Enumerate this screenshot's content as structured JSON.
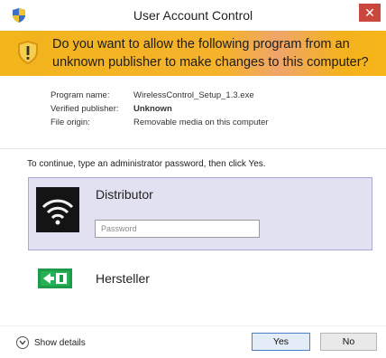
{
  "window": {
    "title": "User Account Control",
    "close_label": "✕"
  },
  "banner": {
    "question": "Do you want to allow the following program from an unknown publisher to make changes to this computer?"
  },
  "program_info": {
    "rows": [
      {
        "label": "Program name:",
        "value": "WirelessControl_Setup_1.3.exe"
      },
      {
        "label": "Verified publisher:",
        "value": "Unknown"
      },
      {
        "label": "File origin:",
        "value": "Removable media on this computer"
      }
    ]
  },
  "instruction": "To continue, type an administrator password, then click Yes.",
  "accounts": [
    {
      "name": "Distributor",
      "password_placeholder": "Password",
      "selected": true
    },
    {
      "name": "Hersteller",
      "selected": false
    }
  ],
  "footer": {
    "show_details_label": "Show details",
    "yes_label": "Yes",
    "no_label": "No"
  },
  "colors": {
    "banner": "#f4b21f",
    "close_button": "#c9473c",
    "selected_account": "#e2e1f2"
  }
}
